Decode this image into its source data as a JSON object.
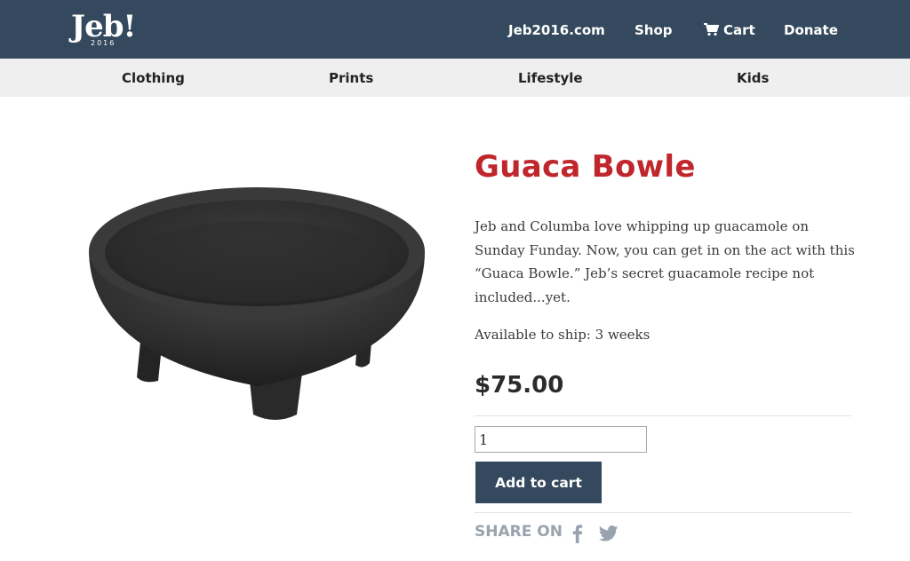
{
  "header": {
    "logo_text": "Jeb!",
    "logo_year": "2016",
    "nav": {
      "jeb2016": "Jeb2016.com",
      "shop": "Shop",
      "cart": "Cart",
      "donate": "Donate"
    },
    "icons": {
      "cart": "cart-icon"
    },
    "background_color": "#34495e"
  },
  "categories": [
    "Clothing",
    "Prints",
    "Lifestyle",
    "Kids"
  ],
  "product": {
    "title": "Guaca Bowle",
    "description": "Jeb and Columba love whipping up guacamole on Sunday Funday. Now, you can get in on the act with this “Guaca Bowle.” Jeb’s secret guacamole recipe not included...yet.",
    "shipping": "Available to ship: 3 weeks",
    "price": "$75.00",
    "quantity": "1",
    "add_to_cart_label": "Add to cart",
    "title_color": "#c0272d"
  },
  "share": {
    "label": "SHARE ON",
    "icons": [
      "facebook-icon",
      "twitter-icon"
    ]
  }
}
